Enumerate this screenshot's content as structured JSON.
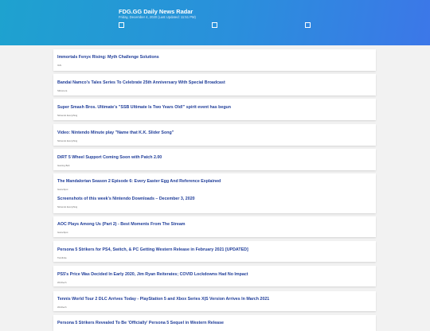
{
  "header": {
    "title": "FDG.GG Daily News Radar",
    "subtitle": "Friday, December 4, 2020 (Last Updated: 11:51 PM)",
    "toggles": [
      {
        "label": "",
        "checked": false
      },
      {
        "label": "",
        "checked": false
      },
      {
        "label": "",
        "checked": false
      }
    ]
  },
  "items": [
    {
      "title": "Immortals Fenyx Rising: Myth Challenge Solutions",
      "source": "IGN"
    },
    {
      "title": "Bandai Namco's Tales Series To Celebrate 25th Anniversary With Special Broadcast",
      "source": "Siliconera"
    },
    {
      "title": "Super Smash Bros. Ultimate's \"SSB Ultimate Is Two Years Old!\" spirit event has begun",
      "source": "Nintendo Everything"
    },
    {
      "title": "Video: Nintendo Minute play \"Name that K.K. Slider Song\"",
      "source": "Nintendo Everything"
    },
    {
      "title": "DiRT 5 Wheel Support Coming Soon with Patch 2.00",
      "source": "Gaming Bolt"
    },
    {
      "title": "The Mandalorian Season 2 Episode 6: Every Easter Egg And Reference Explained",
      "source": "GameSpot"
    },
    {
      "title": "Screenshots of this week's Nintendo Downloads – December 3, 2020",
      "source": "Nintendo Everything"
    },
    {
      "title": "AOC Plays Among Us (Part 2) - Best Moments From The Stream",
      "source": "GameSpot"
    },
    {
      "title": "Persona 5 Strikers for PS4, Switch, & PC Getting Western Release in February 2021 [UPDATED]",
      "source": "Twinfinite"
    },
    {
      "title": "PS5's Price Was Decided In Early 2020, Jim Ryan Reiterates; COVID Lockdowns Had No Impact",
      "source": "Wccftech"
    },
    {
      "title": "Tennis World Tour 2 DLC Arrives Today - PlayStation 5 and Xbox Series X|S Version Arrives In March 2021",
      "source": "Wccftech"
    },
    {
      "title": "Persona 5 Strikers Revealed To Be 'Officially' Persona 5 Sequel in Western Release",
      "source": ""
    }
  ]
}
